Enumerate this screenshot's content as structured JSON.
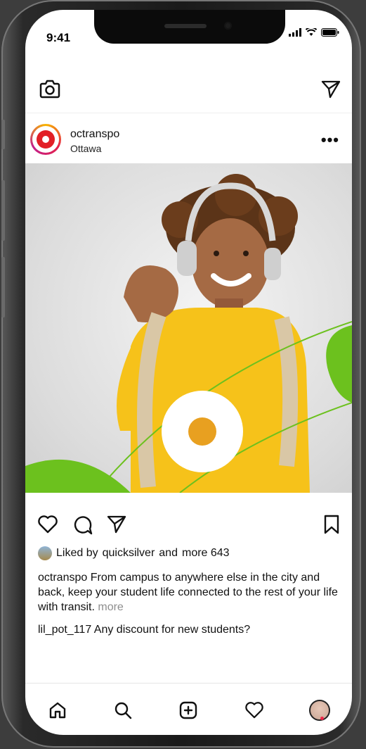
{
  "status_bar": {
    "time": "9:41"
  },
  "post": {
    "username": "octranspo",
    "location": "Ottawa",
    "more_menu": "•••",
    "liked_by_prefix": "Liked by",
    "liked_by_user": "quicksilver",
    "liked_by_and": "and",
    "liked_by_more": "more 643",
    "caption_user": "octranspo",
    "caption_text": "From campus to anywhere else in the city and back, keep your student life connected to the rest of your life with transit.",
    "caption_more": "more",
    "comment_user": "lil_pot_117",
    "comment_text": "Any discount for new students?"
  },
  "icons": {
    "camera": "camera-icon",
    "direct": "paper-plane-icon",
    "like": "heart-icon",
    "comment": "comment-bubble-icon",
    "share": "paper-plane-icon",
    "save": "bookmark-icon",
    "home": "home-icon",
    "search": "search-icon",
    "add": "plus-square-icon",
    "activity": "heart-icon",
    "profile": "avatar"
  },
  "colors": {
    "brand_red": "#e21f26",
    "brand_green": "#6cc11e",
    "sweater_yellow": "#f6c21a",
    "notification_dot": "#ed2849"
  }
}
